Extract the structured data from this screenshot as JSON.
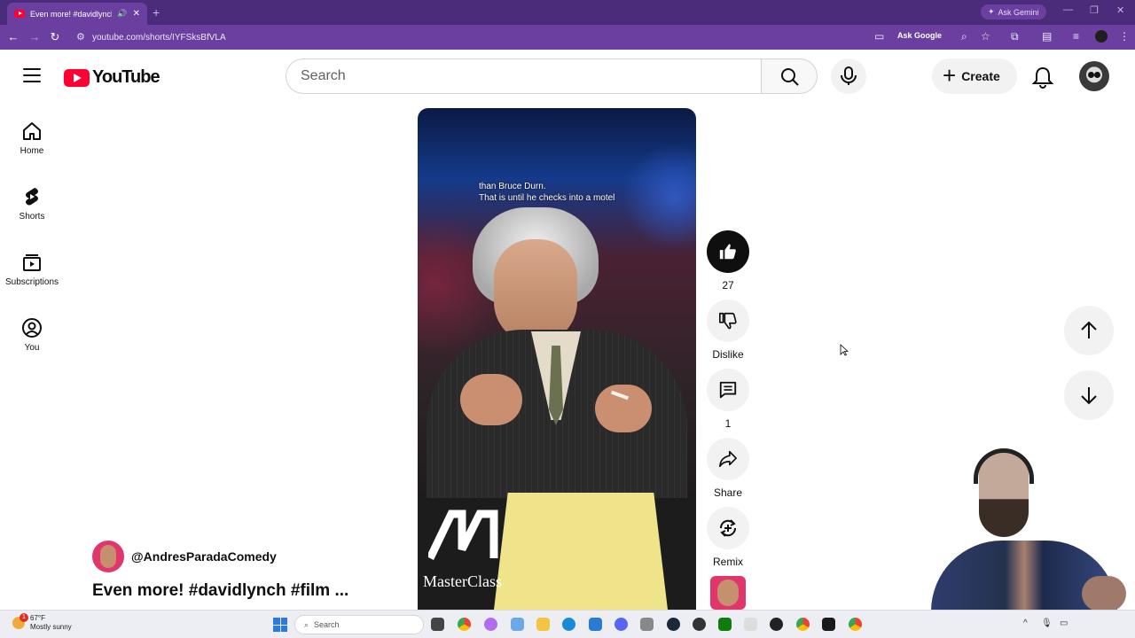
{
  "browser": {
    "tab_title": "Even more! #davidlynch #film",
    "tab_close": "✕",
    "new_tab": "+",
    "ask_gemini": "Ask Gemini",
    "url": "youtube.com/shorts/IYFSksBfVLA",
    "ask_google": "Ask Google",
    "window_controls": [
      "—",
      "❐",
      "✕"
    ]
  },
  "header": {
    "logo_text": "YouTube",
    "search_placeholder": "Search",
    "create_label": "Create"
  },
  "guide": {
    "items": [
      {
        "label": "Home",
        "icon": "home-icon"
      },
      {
        "label": "Shorts",
        "icon": "shorts-icon"
      },
      {
        "label": "Subscriptions",
        "icon": "subscriptions-icon"
      },
      {
        "label": "You",
        "icon": "you-icon"
      }
    ]
  },
  "video": {
    "caption_line1": "than Bruce Durn.",
    "caption_line2": "That is until he checks into a motel",
    "watermark": "MasterClass"
  },
  "actions": {
    "like_count": "27",
    "dislike_label": "Dislike",
    "comment_count": "1",
    "share_label": "Share",
    "remix_label": "Remix"
  },
  "short": {
    "channel": "@AndresParadaComedy",
    "title": "Even more! #davidlynch #film ..."
  },
  "taskbar": {
    "temperature": "67°F",
    "condition": "Mostly sunny",
    "notification_badge": "1",
    "search_label": "Search"
  },
  "colors": {
    "chrome_purple": "#6a3fa0",
    "youtube_red": "#ff0033",
    "like_active": "#0f0f0f"
  }
}
